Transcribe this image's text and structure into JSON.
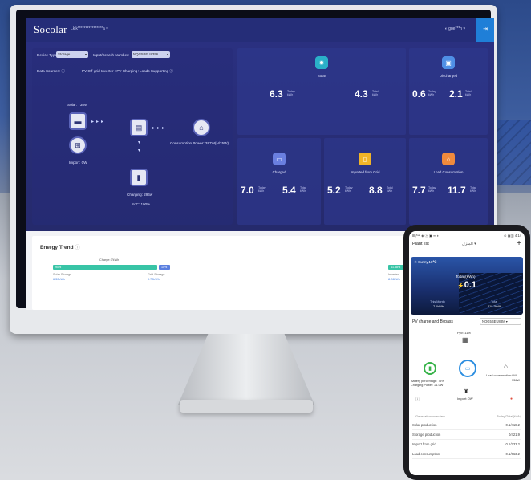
{
  "header": {
    "brand": "Socolar",
    "account": "Lklk****************a",
    "user": "gue***n"
  },
  "filters": {
    "device_type_label": "Device Type:",
    "device_type_value": "Storage",
    "inputs_label": "Input/Search Number:",
    "inputs_value": "NQG5BEU8356"
  },
  "data_sources": {
    "label": "Data Sources: ⓘ",
    "mode": "PV Off-grid Inverter : PV Charging+Loads Supporting ⓘ"
  },
  "flow": {
    "solar": "Solar:  735W",
    "import": "Import:  0W",
    "consumption": "Consumption Power:  397W(N/25W)",
    "charging": "Charging:  296w",
    "soc": "SoC:  100%"
  },
  "tiles": {
    "solar": {
      "name": "Solar",
      "today": "6.3",
      "total": "4.3"
    },
    "discharged": {
      "name": "Discharged",
      "today": "0.6",
      "total": "2.1"
    },
    "charged": {
      "name": "Charged",
      "today": "7.0",
      "total": "5.4"
    },
    "imported": {
      "name": "Imported from Grid",
      "today": "5.2",
      "total": "8.8"
    },
    "load": {
      "name": "Load Consumption",
      "today": "7.7",
      "total": "11.7"
    },
    "today_label": "Today",
    "total_label": "Total",
    "unit": "kWh"
  },
  "trend": {
    "title": "Energy Trend",
    "info": "ⓘ",
    "charge_label": "Charge: 7kWh",
    "load_label": "Load",
    "bar1_pct": "90%",
    "bar2_pct": "10%",
    "bar3_pct": "41.38%",
    "solar_storage": "Solar Storage",
    "solar_storage_val": "6.30kWh",
    "grid_storage": "Grid Storage",
    "grid_storage_val": "0.70kWh",
    "inverter": "Inverter",
    "inverter_val": "8.26kWh",
    "year_btn": "20"
  },
  "phone": {
    "status": "Ⅲiᵢᵀᵃᶦᵑ ◈ ⓐ ▣ ∞ ◑ ·",
    "clock": "⊙ ▣◨ 4:14",
    "plant_list": "Plant list",
    "plant_name": "المنزل",
    "weather": "Sunny,18℃",
    "today_kwh": "Today(kWh)",
    "today_value": "0.1",
    "this_month": "This Month",
    "this_month_val": "7.1kWh",
    "total_label": "Total",
    "total_val": "418.2kWh",
    "section_title": "PV charge and Bypass",
    "device_select": "NQG5BEU83M",
    "ppv": "Ppv: 11%",
    "battery": "Battery percentage: 75%",
    "charging_power": "Charging Power: 21.0W",
    "load_consumption": "Load consumption:8W",
    "load_value": "336W",
    "import": "Import: 0W",
    "overview_title": "Generation overview",
    "overview_cols": "Today/Total(kWh)",
    "rows": [
      {
        "name": "Solar production",
        "val": "0.1/418.2"
      },
      {
        "name": "Storage production",
        "val": "0/421.9"
      },
      {
        "name": "Import from grid",
        "val": "0.1/733.2"
      },
      {
        "name": "Load consumption",
        "val": "0.1/663.2"
      }
    ]
  },
  "colors": {
    "header": "#252d78",
    "accent": "#1f7fd8",
    "bar_green": "#38c4a6",
    "bar_blue": "#5a7fe0"
  }
}
